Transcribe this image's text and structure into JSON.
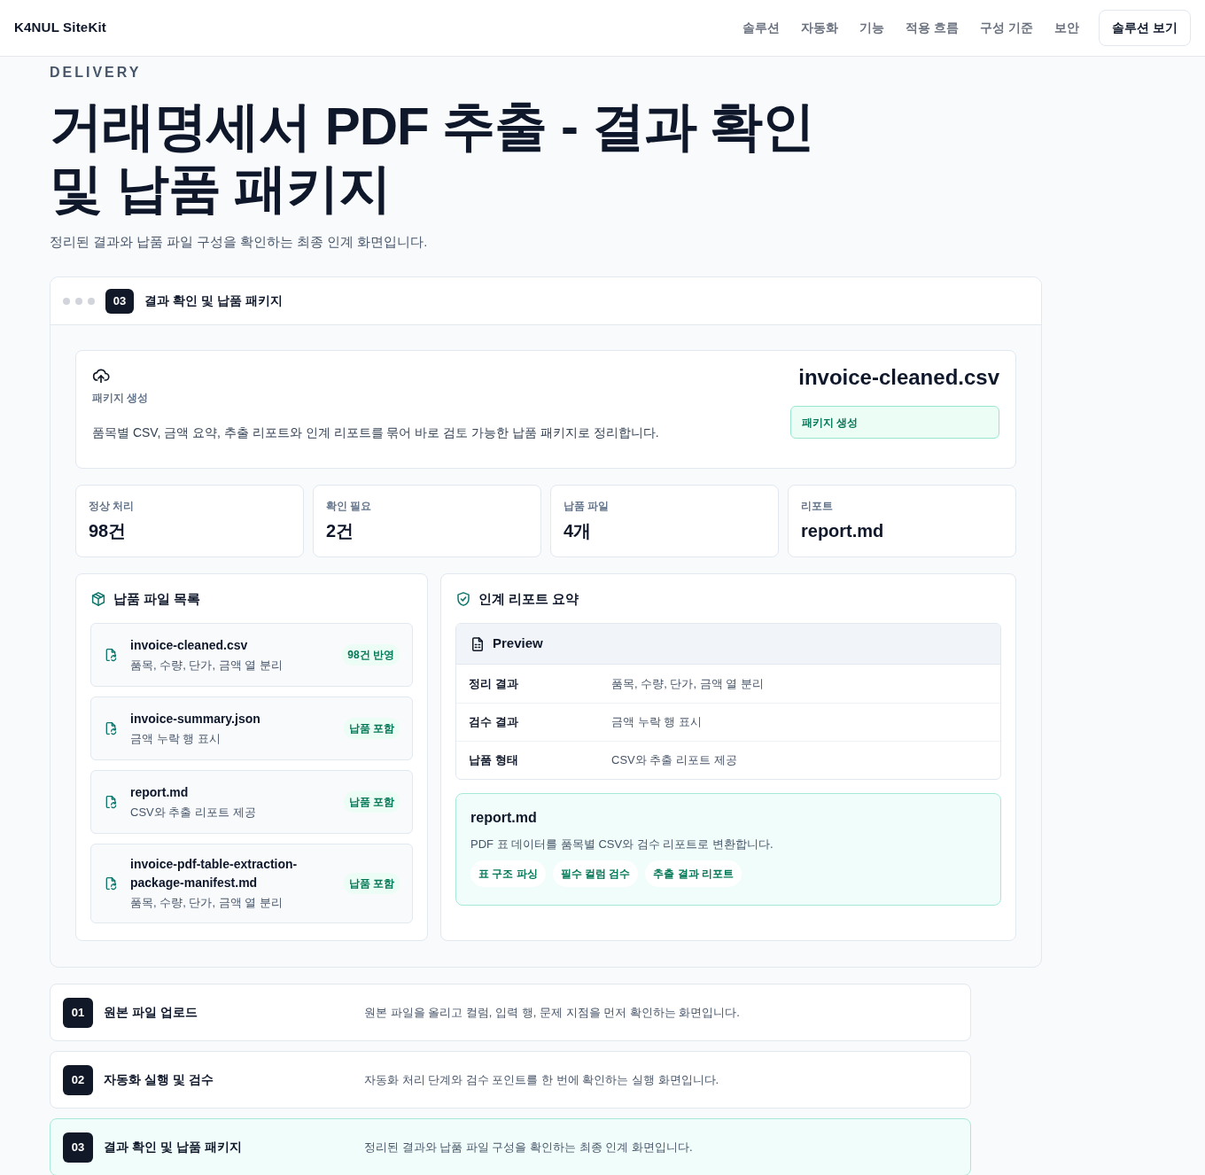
{
  "navbar": {
    "brand": "K4NUL SiteKit",
    "links": [
      "솔루션",
      "자동화",
      "기능",
      "적용 흐름",
      "구성 기준",
      "보안"
    ],
    "cta": "솔루션 보기"
  },
  "hero": {
    "eyebrow": "DELIVERY",
    "title": "거래명세서 PDF 추출 - 결과 확인 및 납품 패키지",
    "subtitle": "정리된 결과와 납품 파일 구성을 확인하는 최종 인계 화면입니다."
  },
  "panel": {
    "step": "03",
    "title": "결과 확인 및 납품 패키지",
    "summary": {
      "label": "패키지 생성",
      "description": "품목별 CSV, 금액 요약, 추출 리포트와 인계 리포트를 묶어 바로 검토 가능한 납품 패키지로 정리합니다.",
      "file": "invoice-cleaned.csv",
      "status": "패키지 생성"
    },
    "stats": [
      {
        "label": "정상 처리",
        "value": "98건"
      },
      {
        "label": "확인 필요",
        "value": "2건"
      },
      {
        "label": "납품 파일",
        "value": "4개"
      },
      {
        "label": "리포트",
        "value": "report.md"
      }
    ],
    "files_panel": {
      "title": "납품 파일 목록",
      "files": [
        {
          "name": "invoice-cleaned.csv",
          "description": "품목, 수량, 단가, 금액 열 분리",
          "badge": "98건 반영"
        },
        {
          "name": "invoice-summary.json",
          "description": "금액 누락 행 표시",
          "badge": "납품 포함"
        },
        {
          "name": "report.md",
          "description": "CSV와 추출 리포트 제공",
          "badge": "납품 포함"
        },
        {
          "name": "invoice-pdf-table-extraction-package-manifest.md",
          "description": "품목, 수량, 단가, 금액 열 분리",
          "badge": "납품 포함"
        }
      ]
    },
    "report_panel": {
      "title": "인계 리포트 요약",
      "preview": {
        "title": "Preview",
        "rows": [
          {
            "label": "정리 결과",
            "value": "품목, 수량, 단가, 금액 열 분리"
          },
          {
            "label": "검수 결과",
            "value": "금액 누락 행 표시"
          },
          {
            "label": "납품 형태",
            "value": "CSV와 추출 리포트 제공"
          }
        ]
      },
      "highlight": {
        "title": "report.md",
        "description": "PDF 표 데이터를 품목별 CSV와 검수 리포트로 변환합니다.",
        "tags": [
          "표 구조 파싱",
          "필수 컬럼 검수",
          "추출 결과 리포트"
        ]
      }
    }
  },
  "steps": [
    {
      "number": "01",
      "title": "원본 파일 업로드",
      "description": "원본 파일을 올리고 컬럼, 입력 행, 문제 지점을 먼저 확인하는 화면입니다.",
      "selected": false
    },
    {
      "number": "02",
      "title": "자동화 실행 및 검수",
      "description": "자동화 처리 단계와 검수 포인트를 한 번에 확인하는 실행 화면입니다.",
      "selected": false
    },
    {
      "number": "03",
      "title": "결과 확인 및 납품 패키지",
      "description": "정리된 결과와 납품 파일 구성을 확인하는 최종 인계 화면입니다.",
      "selected": true
    }
  ]
}
